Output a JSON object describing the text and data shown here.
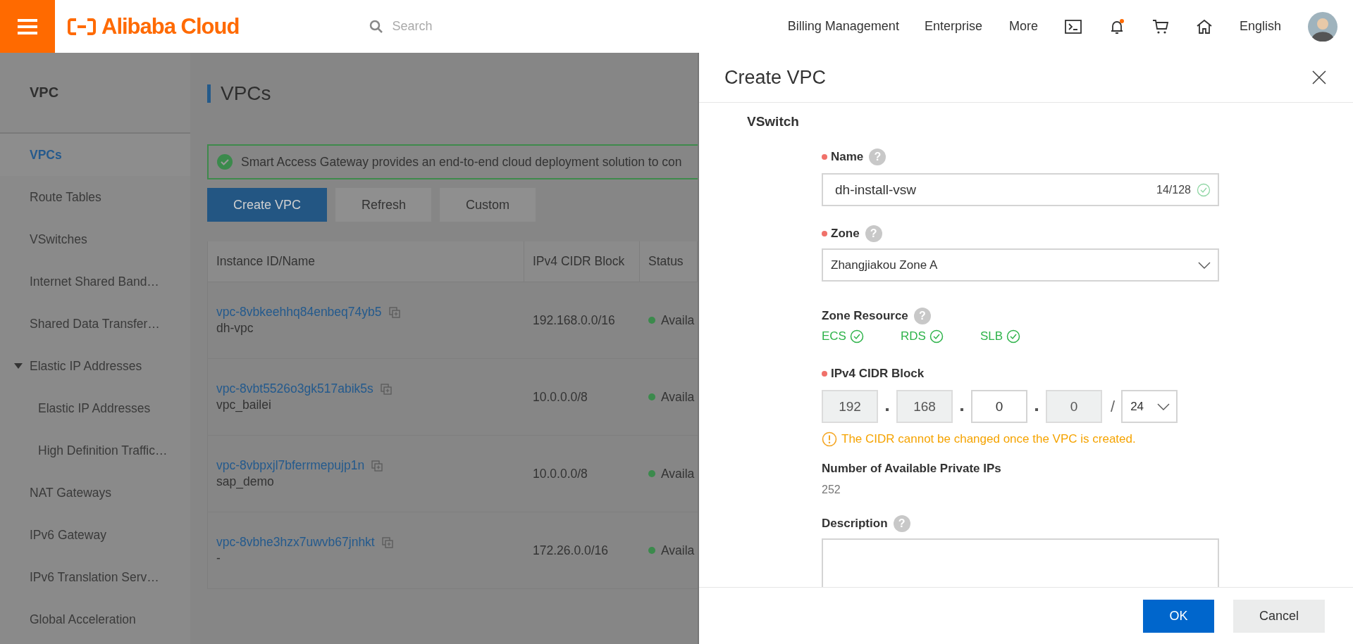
{
  "header": {
    "logo": "Alibaba Cloud",
    "search": {
      "placeholder": "Search"
    },
    "links": [
      "Billing Management",
      "Enterprise",
      "More"
    ],
    "bell_has_notification": true,
    "language": "English"
  },
  "sidebar": {
    "title": "VPC",
    "items": [
      {
        "label": "VPCs",
        "selected": true
      },
      {
        "label": "Route Tables",
        "selected": false
      },
      {
        "label": "VSwitches",
        "selected": false
      },
      {
        "label": "Internet Shared Band…",
        "selected": false
      },
      {
        "label": "Shared Data Transfer…",
        "selected": false
      },
      {
        "label": "Elastic IP Addresses",
        "selected": false,
        "expanded": true,
        "children": [
          {
            "label": "Elastic IP Addresses",
            "selected": false
          },
          {
            "label": "High Definition Traffic…",
            "selected": false
          }
        ]
      },
      {
        "label": "NAT Gateways",
        "selected": false
      },
      {
        "label": "IPv6 Gateway",
        "selected": false
      },
      {
        "label": "IPv6 Translation Serv…",
        "selected": false
      },
      {
        "label": "Global Acceleration",
        "selected": false
      }
    ]
  },
  "page": {
    "title": "VPCs",
    "notice": "Smart Access Gateway provides an end-to-end cloud deployment solution to con",
    "buttons": [
      {
        "label": "Create VPC",
        "kind": "primary"
      },
      {
        "label": "Refresh",
        "kind": "default"
      },
      {
        "label": "Custom",
        "kind": "default"
      }
    ],
    "table": {
      "columns": [
        "Instance ID/Name",
        "IPv4 CIDR Block",
        "Status"
      ],
      "rows": [
        {
          "id": "vpc-8vbkeehhq84enbeq74yb5",
          "name": "dh-vpc",
          "cidr": "192.168.0.0/16",
          "status": "Availa"
        },
        {
          "id": "vpc-8vbt5526o3gk517abik5s",
          "name": "vpc_bailei",
          "cidr": "10.0.0.0/8",
          "status": "Availa"
        },
        {
          "id": "vpc-8vbpxjl7bferrmepujp1n",
          "name": "sap_demo",
          "cidr": "10.0.0.0/8",
          "status": "Availa"
        },
        {
          "id": "vpc-8vbhe3hzx7uwvb67jnhkt",
          "name": "-",
          "cidr": "172.26.0.0/16",
          "status": "Availa"
        }
      ]
    }
  },
  "drawer": {
    "title": "Create VPC",
    "section": "VSwitch",
    "name_field": {
      "label": "Name",
      "required": true,
      "help": "?",
      "value": "dh-install-vsw",
      "counter": "14/128",
      "valid": true
    },
    "zone_field": {
      "label": "Zone",
      "required": true,
      "help": "?",
      "value": "Zhangjiakou Zone A"
    },
    "zone_resource": {
      "label": "Zone Resource",
      "help": "?",
      "items": [
        "ECS",
        "RDS",
        "SLB"
      ]
    },
    "cidr": {
      "label": "IPv4 CIDR Block",
      "required": true,
      "octets": [
        {
          "value": "192",
          "disabled": true
        },
        {
          "value": "168",
          "disabled": true
        },
        {
          "value": "0",
          "disabled": false
        },
        {
          "value": "0",
          "disabled": true
        }
      ],
      "separator": "/",
      "mask": "24"
    },
    "warning": "The CIDR cannot be changed once the VPC is created.",
    "private_ips": {
      "label": "Number of Available Private IPs",
      "value": "252"
    },
    "description": {
      "label": "Description",
      "help": "?"
    },
    "buttons": [
      {
        "label": "OK",
        "kind": "primary"
      },
      {
        "label": "Cancel",
        "kind": "default"
      }
    ]
  }
}
